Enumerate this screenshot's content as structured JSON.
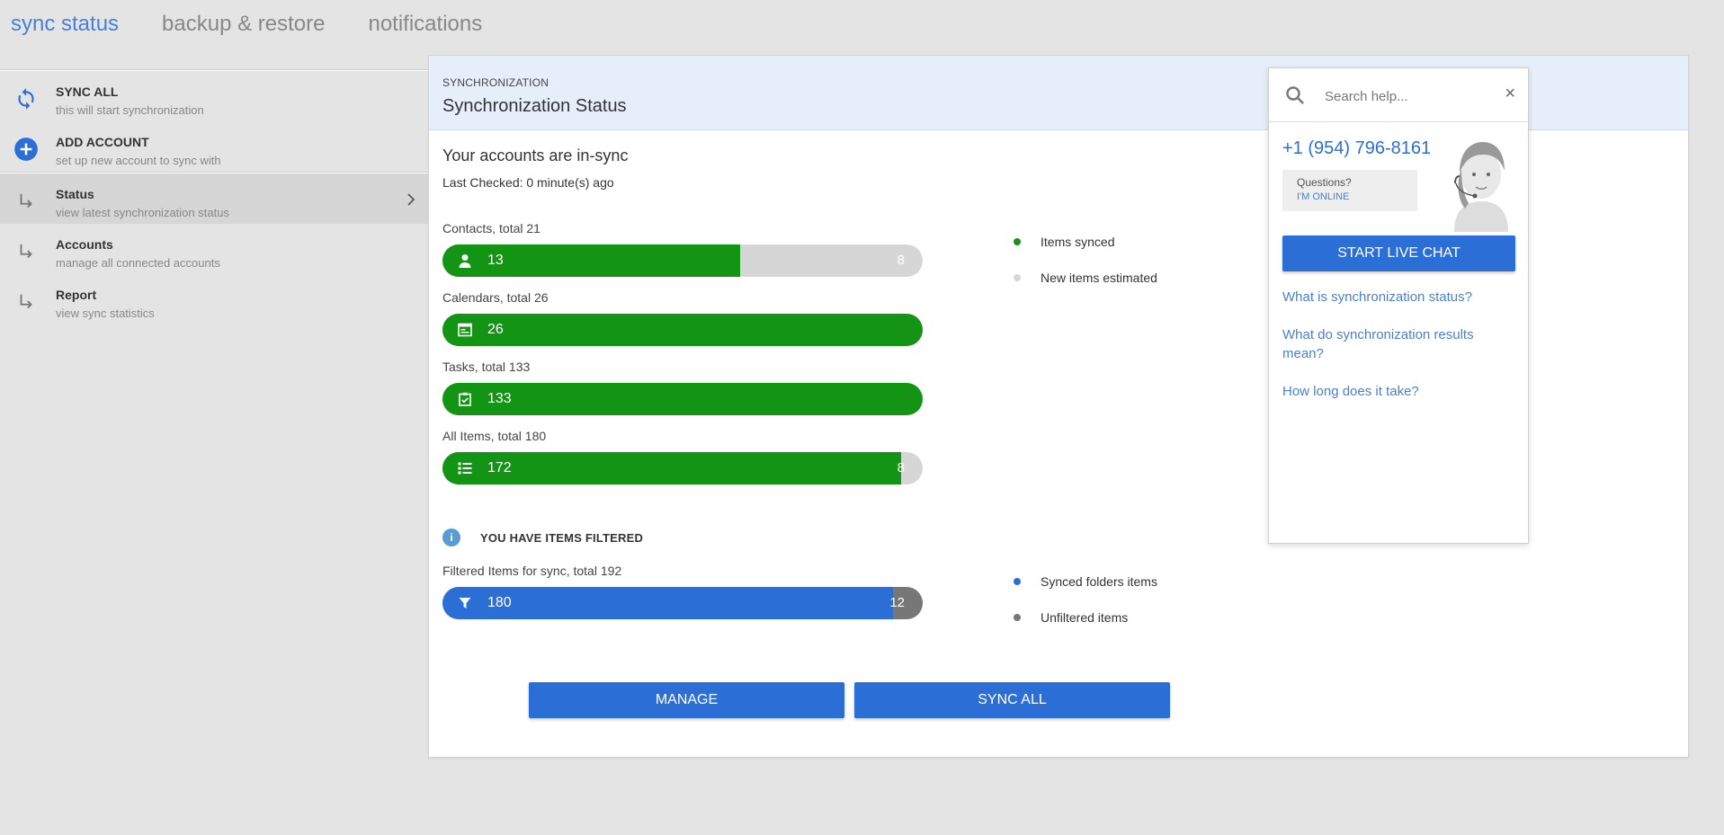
{
  "tabs": [
    "sync status",
    "backup & restore",
    "notifications"
  ],
  "sidebar": {
    "actions": [
      {
        "title": "SYNC ALL",
        "sub": "this will start synchronization",
        "icon": "sync-icon"
      },
      {
        "title": "ADD ACCOUNT",
        "sub": "set up new account to sync with",
        "icon": "plus-circle-icon"
      }
    ],
    "nav": [
      {
        "title": "Status",
        "sub": "view latest synchronization status",
        "icon": "subdirectory-arrow-icon"
      },
      {
        "title": "Accounts",
        "sub": "manage all connected accounts",
        "icon": "subdirectory-arrow-icon"
      },
      {
        "title": "Report",
        "sub": "view sync statistics",
        "icon": "subdirectory-arrow-icon"
      }
    ]
  },
  "panel": {
    "kicker": "SYNCHRONIZATION",
    "title": "Synchronization Status",
    "status_heading": "Your accounts are in-sync",
    "last_checked": "Last Checked: 0 minute(s) ago",
    "bars": [
      {
        "label": "Contacts, total 21",
        "synced": 13,
        "new": 8,
        "synced_text": "13",
        "new_text": "8",
        "icon": "person-icon"
      },
      {
        "label": "Calendars, total 26",
        "synced": 26,
        "new": 0,
        "synced_text": "26",
        "new_text": "",
        "icon": "calendar-icon"
      },
      {
        "label": "Tasks, total 133",
        "synced": 133,
        "new": 0,
        "synced_text": "133",
        "new_text": "",
        "icon": "task-icon"
      },
      {
        "label": "All Items, total 180",
        "synced": 172,
        "new": 8,
        "synced_text": "172",
        "new_text": "8",
        "icon": "list-icon"
      }
    ],
    "legend": [
      {
        "label": "Items synced",
        "color": "#149414"
      },
      {
        "label": "New items estimated",
        "color": "#d6d6d6"
      }
    ],
    "filtered_notice": "YOU HAVE ITEMS FILTERED",
    "info_glyph": "i",
    "filtered_bar": {
      "label": "Filtered Items for sync, total 192",
      "synced": 180,
      "rest": 12,
      "synced_text": "180",
      "rest_text": "12",
      "icon": "filter-icon"
    },
    "legend2": [
      {
        "label": "Synced folders items",
        "color": "#2b6fd6"
      },
      {
        "label": "Unfiltered items",
        "color": "#777777"
      }
    ],
    "buttons": {
      "manage": "MANAGE",
      "sync_all": "SYNC ALL"
    }
  },
  "help": {
    "search_placeholder": "Search help...",
    "close_glyph": "×",
    "phone": "+1 (954) 796-8161",
    "questions": "Questions?",
    "online": "I'M ONLINE",
    "chat_button": "START LIVE CHAT",
    "links": [
      "What is synchronization status?",
      "What do synchronization results mean?",
      "How long does it take?"
    ]
  },
  "colors": {
    "accent": "#2b6fd6",
    "green": "#149414",
    "tab_active": "#4a7fd4"
  }
}
